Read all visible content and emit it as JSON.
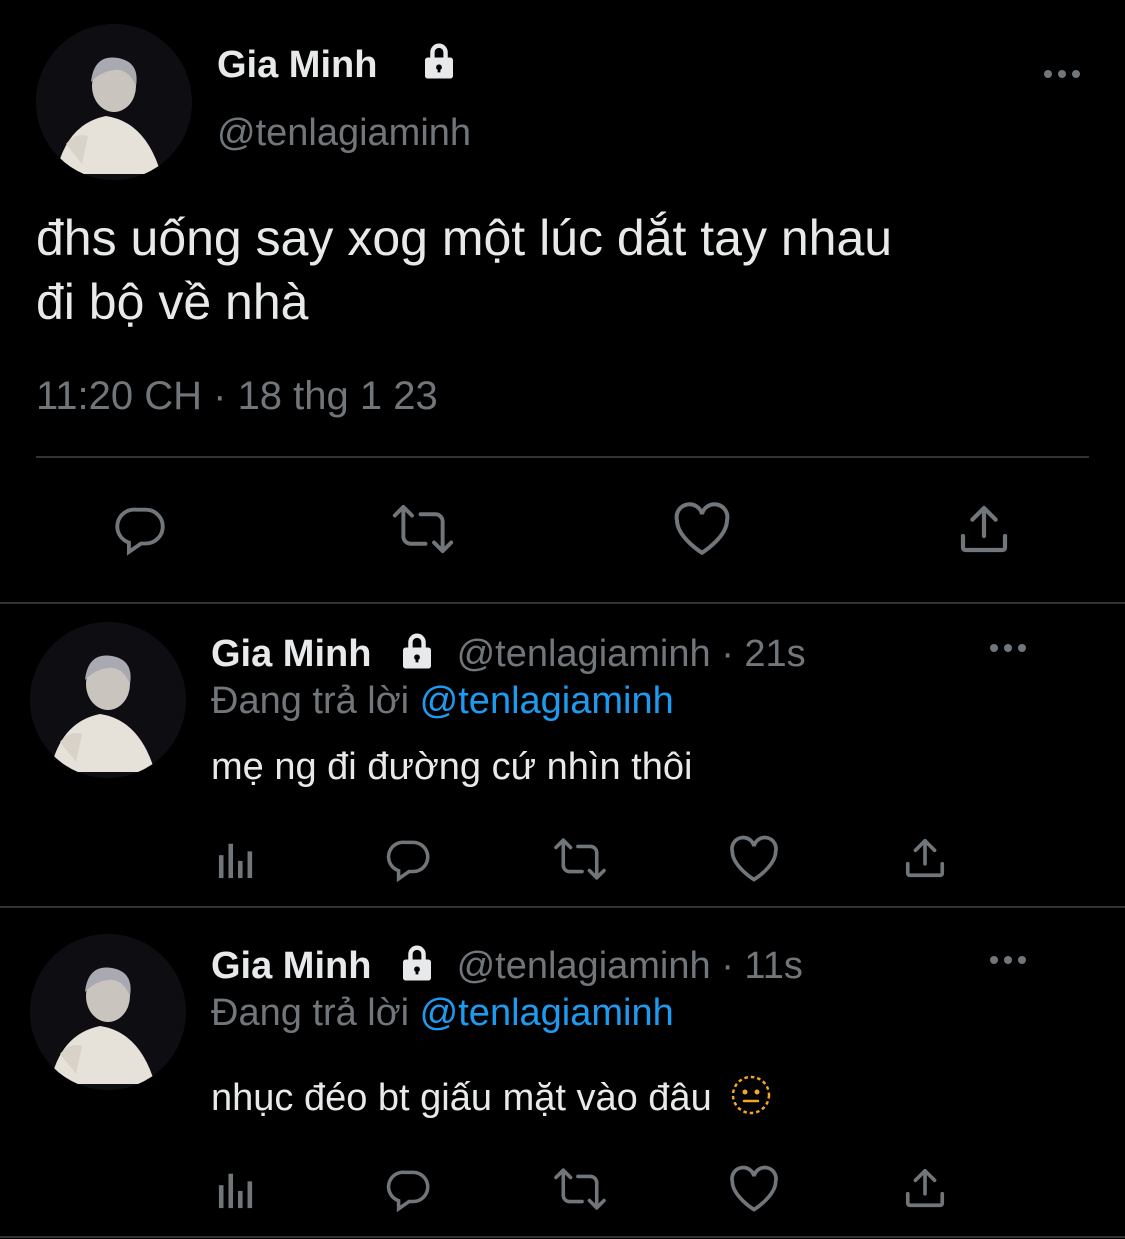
{
  "main_tweet": {
    "display_name": "Gia Minh",
    "handle": "@tenlagiaminh",
    "text_line1": "đhs uống say xog một lúc dắt tay nhau",
    "text_line2": "đi bộ về nhà",
    "timestamp": "11:20 CH · 18 thg 1 23"
  },
  "replies": [
    {
      "display_name": "Gia Minh",
      "handle": "@tenlagiaminh",
      "time": "· 21s",
      "replying_prefix": "Đang trả lời",
      "replying_to": "@tenlagiaminh",
      "text": "mẹ ng đi đường cứ nhìn thôi"
    },
    {
      "display_name": "Gia Minh",
      "handle": "@tenlagiaminh",
      "time": "· 11s",
      "replying_prefix": "Đang trả lời",
      "replying_to": "@tenlagiaminh",
      "text": "nhục đéo bt giấu mặt vào đâu"
    }
  ],
  "icons": {
    "more": "more-icon",
    "lock": "lock-icon",
    "reply": "reply-icon",
    "retweet": "retweet-icon",
    "like": "like-icon",
    "share": "share-icon",
    "analytics": "analytics-icon",
    "emoji": "neutral-face-emoji"
  },
  "colors": {
    "background": "#000000",
    "text": "#e7e9ea",
    "muted": "#71767b",
    "link": "#1d9bf0",
    "divider": "#2f3336"
  }
}
